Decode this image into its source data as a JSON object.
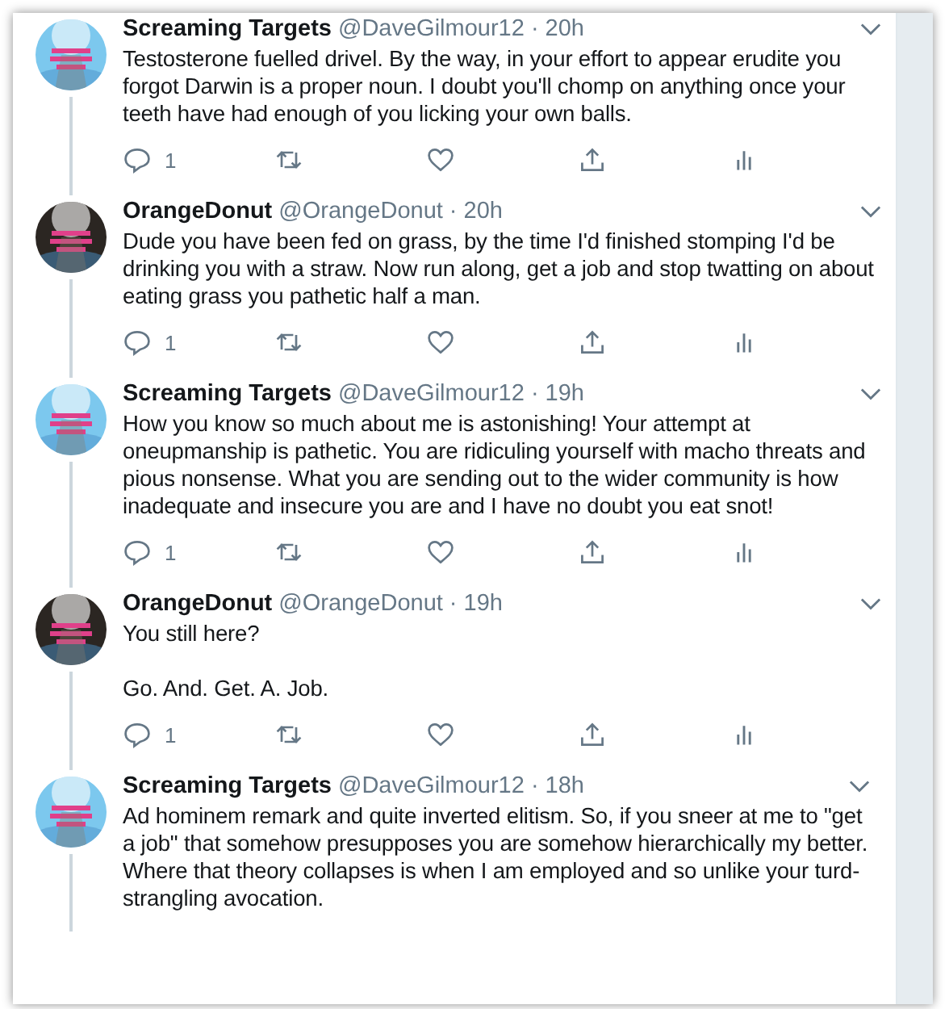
{
  "tweets": [
    {
      "name": "Screaming Targets",
      "handle": "@DaveGilmour12",
      "separator": "·",
      "time": "20h",
      "color": "#7cc8ee",
      "paragraphs": [
        "Testosterone fuelled drivel. By the way, in your effort to appear erudite you forgot Darwin is a proper noun. I doubt you'll chomp on anything once your teeth have had enough of you licking your own balls."
      ],
      "reply_count": "1"
    },
    {
      "name": "OrangeDonut",
      "handle": "@OrangeDonut",
      "separator": "·",
      "time": "20h",
      "color": "#2b2622",
      "paragraphs": [
        "Dude you have been fed on grass, by the time I'd finished stomping I'd be drinking you with a straw. Now run along, get a job and stop twatting on about eating grass you pathetic half a man."
      ],
      "reply_count": "1"
    },
    {
      "name": "Screaming Targets",
      "handle": "@DaveGilmour12",
      "separator": "·",
      "time": "19h",
      "color": "#7cc8ee",
      "paragraphs": [
        "How you know so much about me is astonishing! Your attempt at oneupmanship is pathetic. You are ridiculing yourself with macho threats and pious nonsense. What you are sending out to the wider community is how inadequate and insecure you are and I have no doubt you eat snot!"
      ],
      "reply_count": "1"
    },
    {
      "name": "OrangeDonut",
      "handle": "@OrangeDonut",
      "separator": "·",
      "time": "19h",
      "color": "#2b2622",
      "paragraphs": [
        "You still here?",
        "Go. And. Get. A. Job."
      ],
      "reply_count": "1"
    },
    {
      "name": "Screaming Targets",
      "handle": "@DaveGilmour12",
      "separator": "·",
      "time": "18h",
      "color": "#7cc8ee",
      "paragraphs": [
        "Ad hominem remark and quite inverted elitism. So, if you sneer at me to \"get a job\" that somehow presupposes you are somehow hierarchically my better. Where that theory collapses is when I am employed and so unlike your turd-strangling avocation."
      ]
    }
  ]
}
